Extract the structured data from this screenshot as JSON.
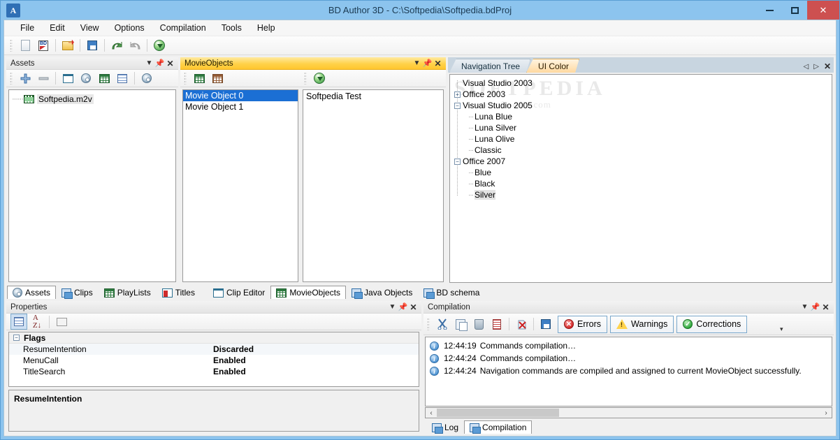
{
  "window": {
    "title": "BD Author 3D - C:\\Softpedia\\Softpedia.bdProj",
    "app_icon": "A",
    "minimize_label": "Minimize",
    "maximize_label": "Maximize",
    "close_label": "Close"
  },
  "menu": {
    "items": [
      "File",
      "Edit",
      "View",
      "Options",
      "Compilation",
      "Tools",
      "Help"
    ]
  },
  "toolbar": {
    "buttons": [
      {
        "name": "new-project-icon",
        "title": "New"
      },
      {
        "name": "new-bd-project-icon",
        "title": "New BD Project"
      },
      {
        "name": "open-folder-icon",
        "title": "Open"
      },
      {
        "name": "save-icon",
        "title": "Save"
      },
      {
        "name": "undo-icon",
        "title": "Undo"
      },
      {
        "name": "redo-icon",
        "title": "Redo"
      },
      {
        "name": "compile-icon",
        "title": "Compile"
      }
    ]
  },
  "assets_panel": {
    "caption": "Assets",
    "toolbar": [
      {
        "name": "add-asset-icon"
      },
      {
        "name": "remove-asset-icon"
      },
      {
        "name": "add-video-icon"
      },
      {
        "name": "add-audio-icon"
      },
      {
        "name": "add-subtitle-icon"
      },
      {
        "name": "asset-properties-icon"
      },
      {
        "name": "burn-disc-icon"
      }
    ],
    "tree": [
      {
        "label": "Softpedia.m2v",
        "icon": "film-icon",
        "selected": true
      }
    ]
  },
  "movieobjects_panel": {
    "caption": "MovieObjects",
    "active": true,
    "toolbar_left": [
      {
        "name": "add-movieobject-icon"
      },
      {
        "name": "remove-movieobject-icon"
      }
    ],
    "toolbar_right": [
      {
        "name": "compile-commands-icon"
      }
    ],
    "list": [
      {
        "label": "Movie Object 0",
        "selected": true
      },
      {
        "label": "Movie Object 1",
        "selected": false
      }
    ],
    "detail_text": "Softpedia Test"
  },
  "nav_panel": {
    "tabs": [
      {
        "label": "Navigation Tree",
        "active": false
      },
      {
        "label": "UI Color",
        "active": true
      }
    ],
    "nav_prev_label": "Previous",
    "nav_next_label": "Next",
    "close_label": "Close",
    "watermark_line1": "SOFTPEDIA",
    "watermark_line2": "www.softpedia.com",
    "tree": [
      {
        "label": "Visual Studio 2003",
        "level": 0,
        "expander": "none",
        "selected": false
      },
      {
        "label": "Office 2003",
        "level": 0,
        "expander": "plus",
        "selected": false
      },
      {
        "label": "Visual Studio 2005",
        "level": 0,
        "expander": "minus",
        "selected": false
      },
      {
        "label": "Luna Blue",
        "level": 1,
        "expander": "none",
        "selected": false
      },
      {
        "label": "Luna Silver",
        "level": 1,
        "expander": "none",
        "selected": false
      },
      {
        "label": "Luna Olive",
        "level": 1,
        "expander": "none",
        "selected": false
      },
      {
        "label": "Classic",
        "level": 1,
        "expander": "none",
        "selected": false
      },
      {
        "label": "Office 2007",
        "level": 0,
        "expander": "minus",
        "selected": false
      },
      {
        "label": "Blue",
        "level": 1,
        "expander": "none",
        "selected": false
      },
      {
        "label": "Black",
        "level": 1,
        "expander": "none",
        "selected": false
      },
      {
        "label": "Silver",
        "level": 1,
        "expander": "none",
        "selected": true
      }
    ]
  },
  "left_tabbar": {
    "group1": [
      {
        "label": "Assets",
        "icon": "assets-icon",
        "active": true
      },
      {
        "label": "Clips",
        "icon": "clips-icon",
        "active": false
      },
      {
        "label": "PlayLists",
        "icon": "playlists-icon",
        "active": false
      },
      {
        "label": "Titles",
        "icon": "titles-icon",
        "active": false
      }
    ],
    "group2": [
      {
        "label": "Clip Editor",
        "icon": "clip-editor-icon",
        "active": false
      },
      {
        "label": "MovieObjects",
        "icon": "movieobjects-icon",
        "active": true
      },
      {
        "label": "Java Objects",
        "icon": "java-objects-icon",
        "active": false
      },
      {
        "label": "BD schema",
        "icon": "bd-schema-icon",
        "active": false
      }
    ]
  },
  "properties_panel": {
    "caption": "Properties",
    "toolbar": [
      {
        "name": "categorized-view-icon"
      },
      {
        "name": "alphabetical-sort-icon"
      },
      {
        "name": "property-pages-icon"
      }
    ],
    "category": "Flags",
    "rows": [
      {
        "name": "ResumeIntention",
        "value": "Discarded"
      },
      {
        "name": "MenuCall",
        "value": "Enabled"
      },
      {
        "name": "TitleSearch",
        "value": "Enabled"
      }
    ],
    "description_title": "ResumeIntention",
    "description_text": ""
  },
  "compilation_panel": {
    "caption": "Compilation",
    "toolbar": [
      {
        "name": "cut-icon"
      },
      {
        "name": "copy-icon"
      },
      {
        "name": "delete-icon"
      },
      {
        "name": "select-all-icon"
      },
      {
        "name": "clear-log-icon"
      },
      {
        "name": "save-log-icon"
      }
    ],
    "filters": [
      {
        "label": "Errors",
        "icon": "error-icon"
      },
      {
        "label": "Warnings",
        "icon": "warning-icon"
      },
      {
        "label": "Corrections",
        "icon": "correction-icon"
      }
    ],
    "overflow_label": "More",
    "messages": [
      {
        "icon": "info-icon",
        "time": "12:44:19",
        "text": "Commands compilation…"
      },
      {
        "icon": "info-icon",
        "time": "12:44:24",
        "text": "Commands compilation…"
      },
      {
        "icon": "info-icon",
        "time": "12:44:24",
        "text": "Navigation commands are compiled and assigned to current MovieObject successfully."
      }
    ],
    "tabs": [
      {
        "label": "Log",
        "icon": "log-icon",
        "active": false
      },
      {
        "label": "Compilation",
        "icon": "compilation-icon",
        "active": true
      }
    ]
  },
  "colors": {
    "title_bar": "#8cc4ee",
    "active_panel_caption": "#ffd24a",
    "selection": "#1b6fd4",
    "close_button": "#cd5050",
    "active_tab": "#ffd9a0"
  }
}
